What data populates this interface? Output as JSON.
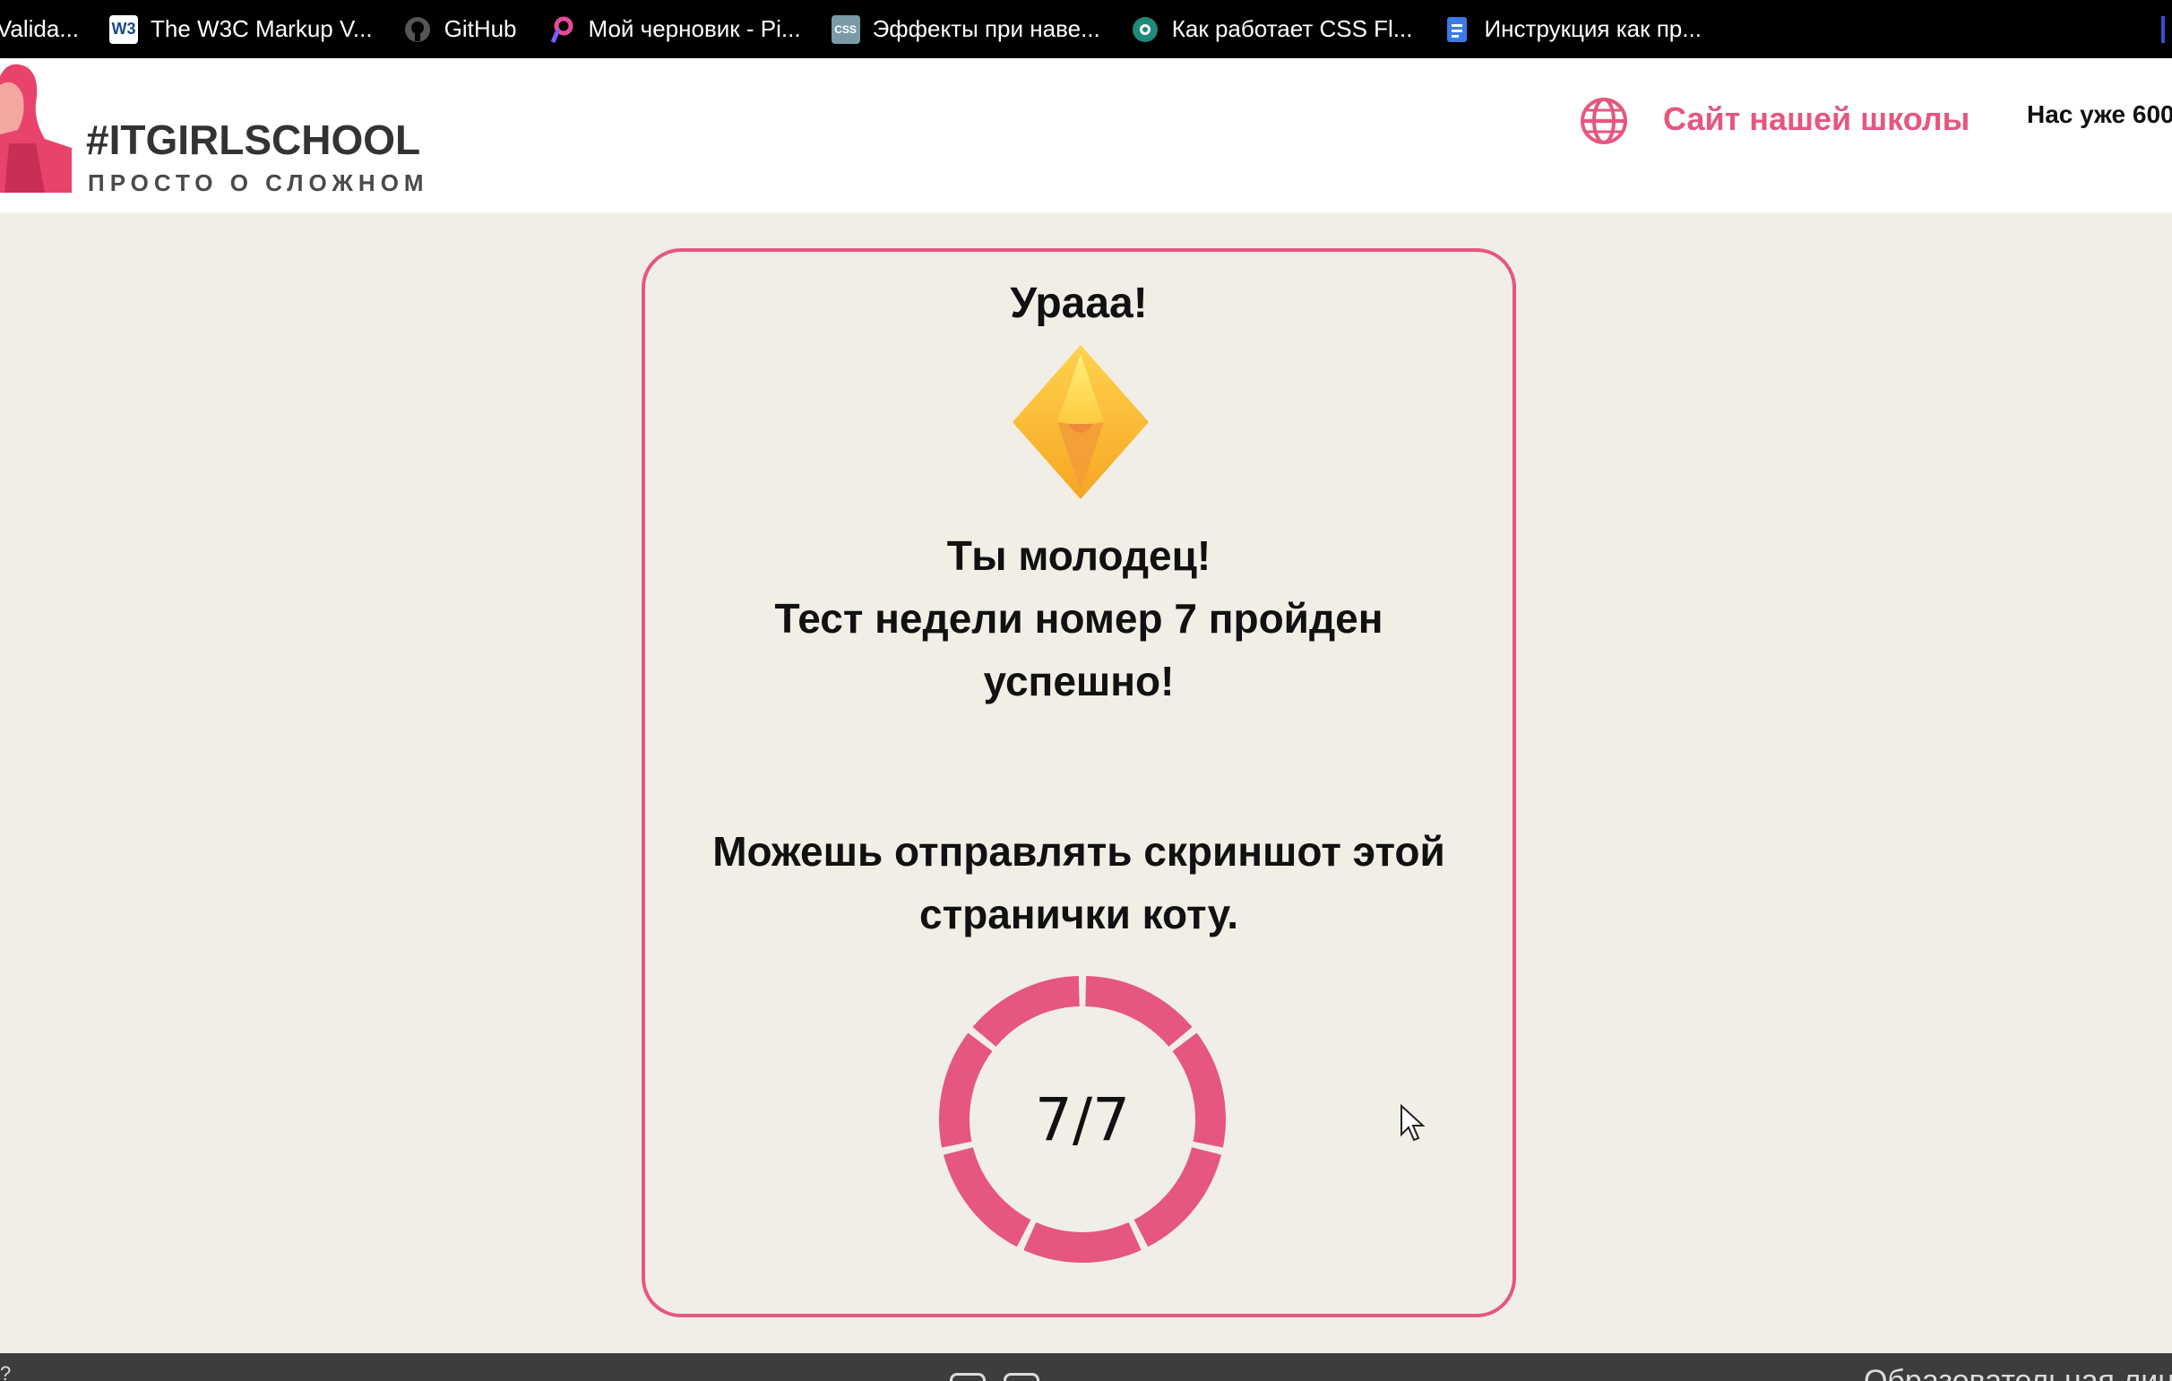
{
  "bookmarks": [
    {
      "label": "Valida...",
      "icon": "validator-icon"
    },
    {
      "label": "The W3C Markup V...",
      "icon": "w3c-icon"
    },
    {
      "label": "GitHub",
      "icon": "github-icon"
    },
    {
      "label": "Мой черновик - Pi...",
      "icon": "pixso-icon"
    },
    {
      "label": "Эффекты при наве...",
      "icon": "css-icon"
    },
    {
      "label": "Как работает CSS Fl...",
      "icon": "site-icon"
    },
    {
      "label": "Инструкция как пр...",
      "icon": "docs-icon"
    }
  ],
  "header": {
    "logo_title": "#ITGIRLSCHOOL",
    "logo_subtitle": "ПРОСТО О СЛОЖНОМ",
    "school_link": "Сайт нашей школы",
    "count_text": "Нас уже 600"
  },
  "result": {
    "title": "Урааа!",
    "message_line1": "Ты молодец!",
    "message_line2": "Тест недели номер 7 пройден",
    "message_line3": "успешно!",
    "action_line1": "Можешь отправлять скриншот этой",
    "action_line2": "странички коту.",
    "score": "7/7",
    "correct": 7,
    "total": 7
  },
  "footer": {
    "left_text": "?",
    "right_text": "Образовательная лиц"
  },
  "colors": {
    "accent": "#e5577f",
    "background": "#f1eee6",
    "bookmarks_bar": "#000000",
    "footer": "#3d3d3d"
  }
}
